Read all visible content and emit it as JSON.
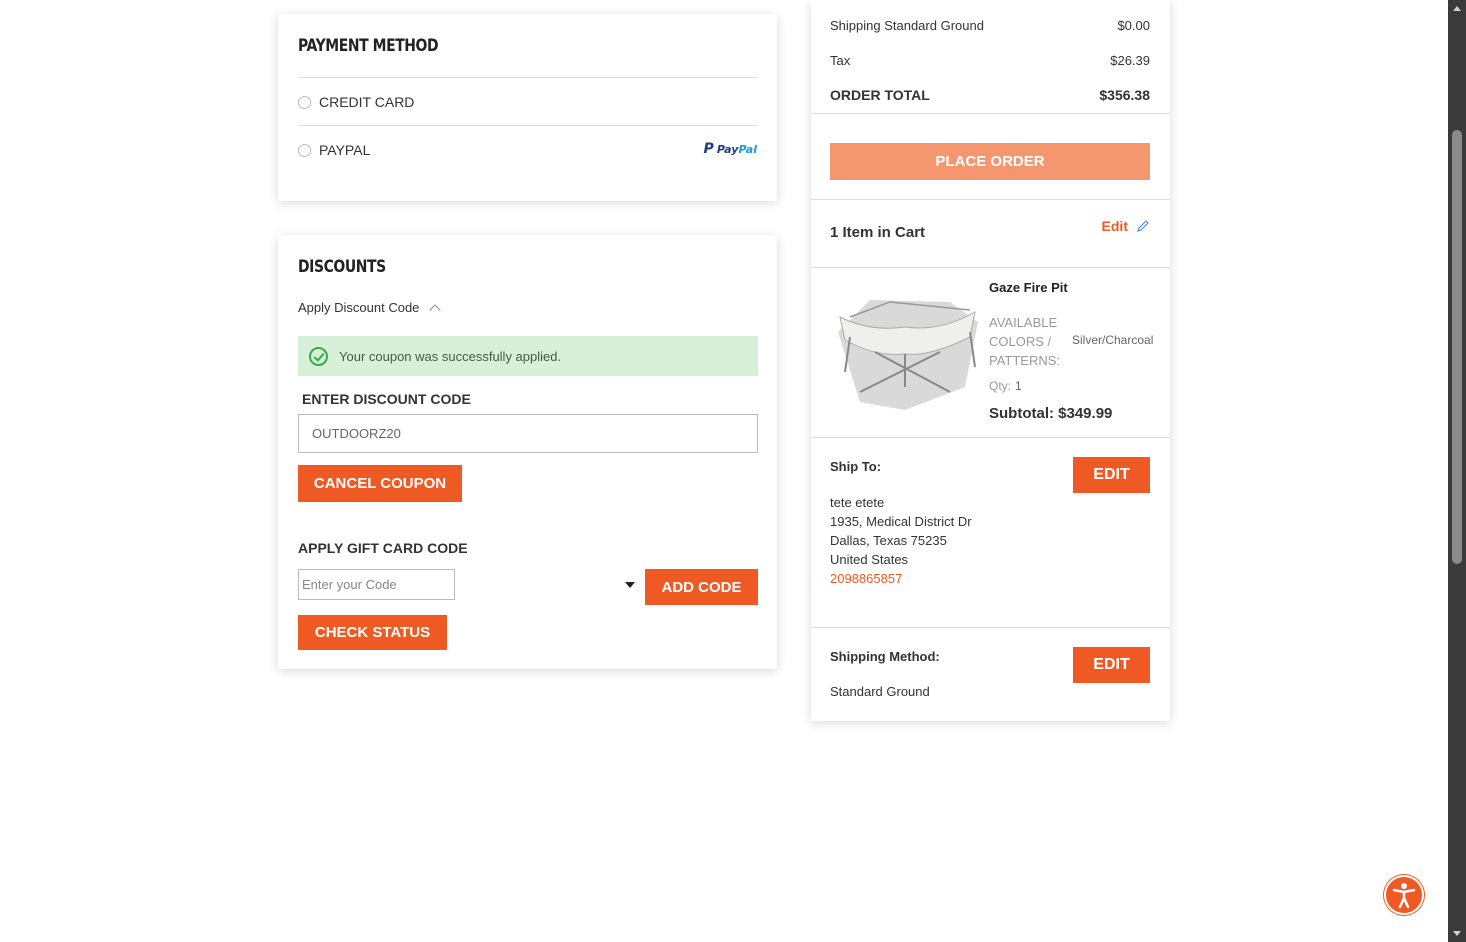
{
  "payment": {
    "title": "PAYMENT METHOD",
    "options": [
      {
        "label": "CREDIT CARD"
      },
      {
        "label": "PAYPAL"
      }
    ],
    "paypal_logo_p": "P",
    "paypal_logo_pay": "Pay",
    "paypal_logo_pal": "Pal"
  },
  "discounts": {
    "title": "DISCOUNTS",
    "toggle_label": "Apply Discount Code",
    "success_message": "Your coupon was successfully applied.",
    "code_label": "ENTER DISCOUNT CODE",
    "code_value": "OUTDOORZ20",
    "cancel_label": "CANCEL COUPON",
    "gift_label": "APPLY GIFT CARD CODE",
    "gift_placeholder": "Enter your Code",
    "add_code_label": "ADD CODE",
    "check_status_label": "CHECK STATUS"
  },
  "summary": {
    "rows": [
      {
        "label": "Shipping Standard Ground",
        "value": "$0.00"
      },
      {
        "label": "Tax",
        "value": "$26.39"
      }
    ],
    "total_label": "ORDER TOTAL",
    "total_value": "$356.38",
    "place_order_label": "PLACE ORDER",
    "cart_count": "1 Item in Cart",
    "edit_label": "Edit",
    "item": {
      "name": "Gaze Fire Pit",
      "attr_label": "AVAILABLE COLORS / PATTERNS:",
      "attr_value": "Silver/Charcoal",
      "qty_label": "Qty:",
      "qty_value": "1",
      "subtotal": "Subtotal: $349.99"
    },
    "ship_to": {
      "label": "Ship To:",
      "edit_label": "EDIT",
      "name": "tete etete",
      "street": "1935, Medical District Dr",
      "city": "Dallas, Texas 75235",
      "country": "United States",
      "phone": "2098865857"
    },
    "shipping_method": {
      "label": "Shipping Method:",
      "edit_label": "EDIT",
      "value": "Standard Ground"
    }
  },
  "colors": {
    "accent": "#ef5a24",
    "accent_disabled": "#f4976f",
    "success_bg": "#d7f0d7",
    "success_icon": "#3aa84b"
  }
}
